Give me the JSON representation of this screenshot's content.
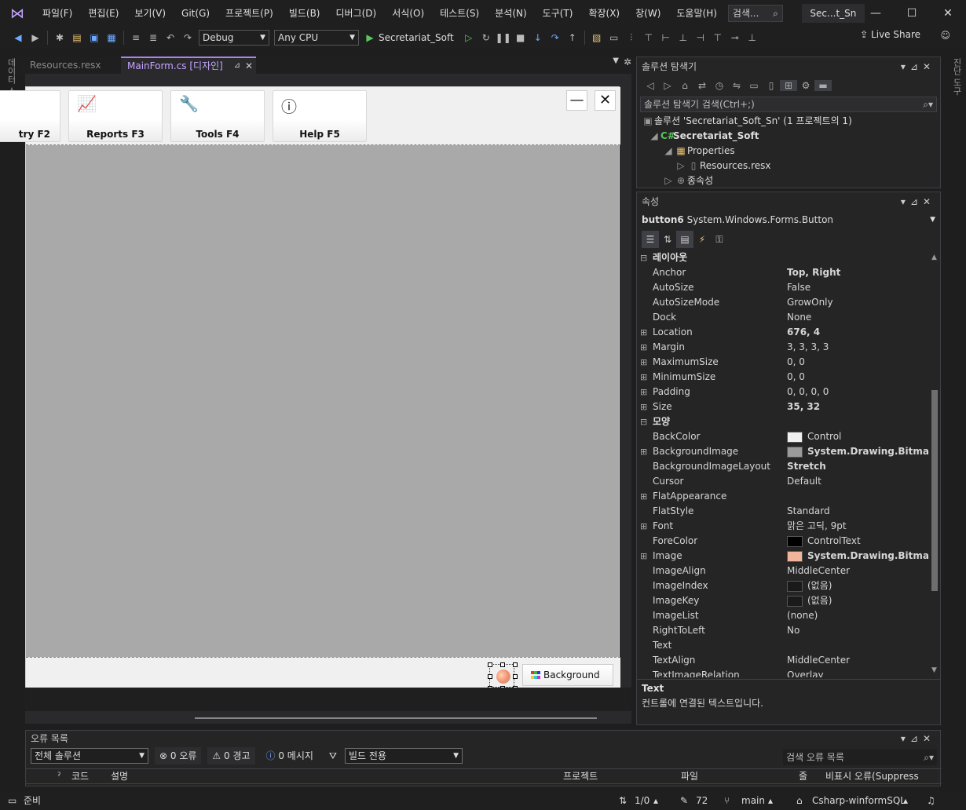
{
  "menu": {
    "items": [
      "파일(F)",
      "편집(E)",
      "보기(V)",
      "Git(G)",
      "프로젝트(P)",
      "빌드(B)",
      "디버그(D)",
      "서식(O)",
      "테스트(S)",
      "분석(N)",
      "도구(T)",
      "확장(X)",
      "창(W)",
      "도움말(H)"
    ],
    "search": "검색...",
    "solution_title": "Sec...t_Sn"
  },
  "toolbar": {
    "config": "Debug",
    "platform": "Any CPU",
    "start_label": "Secretariat_Soft",
    "live_share": "Live Share"
  },
  "rails": {
    "left": "데이터 소스",
    "right": "진단 도구"
  },
  "doc_tabs": {
    "resx": "Resources.resx",
    "main": "MainForm.cs [디자인]"
  },
  "form": {
    "buttons": [
      {
        "label": "try F2",
        "icon": "entry-icon"
      },
      {
        "label": "Reports F3",
        "icon": "chart-icon"
      },
      {
        "label": "Tools F4",
        "icon": "wrench-icon"
      },
      {
        "label": "Help F5",
        "icon": "help-icon"
      }
    ],
    "background_button": "Background"
  },
  "solution_explorer": {
    "title": "솔루션 탐색기",
    "search_placeholder": "솔루션 탐색기 검색(Ctrl+;)",
    "tree": [
      {
        "label": "솔루션 'Secretariat_Soft_Sn' (1 프로젝트의 1)",
        "indent": 0,
        "icon": "solution-icon"
      },
      {
        "label": "Secretariat_Soft",
        "indent": 1,
        "icon": "csharp-project-icon",
        "bold": true
      },
      {
        "label": "Properties",
        "indent": 2,
        "icon": "folder-icon"
      },
      {
        "label": "Resources.resx",
        "indent": 3,
        "icon": "resx-file-icon"
      },
      {
        "label": "종속성",
        "indent": 2,
        "icon": "dependencies-icon"
      }
    ]
  },
  "properties": {
    "title": "속성",
    "object_name": "button6",
    "object_type": "System.Windows.Forms.Button",
    "rows": [
      {
        "type": "cat",
        "name": "레이아웃"
      },
      {
        "name": "Anchor",
        "value": "Top, Right",
        "bold": true
      },
      {
        "name": "AutoSize",
        "value": "False"
      },
      {
        "name": "AutoSizeMode",
        "value": "GrowOnly"
      },
      {
        "name": "Dock",
        "value": "None"
      },
      {
        "name": "Location",
        "value": "676, 4",
        "bold": true,
        "exp": true
      },
      {
        "name": "Margin",
        "value": "3, 3, 3, 3",
        "exp": true
      },
      {
        "name": "MaximumSize",
        "value": "0, 0",
        "exp": true
      },
      {
        "name": "MinimumSize",
        "value": "0, 0",
        "exp": true
      },
      {
        "name": "Padding",
        "value": "0, 0, 0, 0",
        "exp": true
      },
      {
        "name": "Size",
        "value": "35, 32",
        "bold": true,
        "exp": true
      },
      {
        "type": "cat",
        "name": "모양"
      },
      {
        "name": "BackColor",
        "value": "Control",
        "swatch": "#f0f0f0"
      },
      {
        "name": "BackgroundImage",
        "value": "System.Drawing.Bitmap",
        "bold": true,
        "exp": true,
        "swatch": "#9a9a9a"
      },
      {
        "name": "BackgroundImageLayout",
        "value": "Stretch",
        "bold": true
      },
      {
        "name": "Cursor",
        "value": "Default"
      },
      {
        "name": "FlatAppearance",
        "value": "",
        "exp": true
      },
      {
        "name": "FlatStyle",
        "value": "Standard"
      },
      {
        "name": "Font",
        "value": "맑은 고딕, 9pt",
        "exp": true
      },
      {
        "name": "ForeColor",
        "value": "ControlText",
        "swatch": "#000000"
      },
      {
        "name": "Image",
        "value": "System.Drawing.Bitmap",
        "bold": true,
        "exp": true,
        "swatch": "#f2b49a"
      },
      {
        "name": "ImageAlign",
        "value": "MiddleCenter"
      },
      {
        "name": "ImageIndex",
        "value": "(없음)",
        "swatch": "#1a1a1a"
      },
      {
        "name": "ImageKey",
        "value": "(없음)",
        "swatch": "#1a1a1a"
      },
      {
        "name": "ImageList",
        "value": "(none)"
      },
      {
        "name": "RightToLeft",
        "value": "No"
      },
      {
        "name": "Text",
        "value": ""
      },
      {
        "name": "TextAlign",
        "value": "MiddleCenter"
      },
      {
        "name": "TextImageRelation",
        "value": "Overlay"
      }
    ],
    "desc_title": "Text",
    "desc_text": "컨트롤에 연결된 텍스트입니다."
  },
  "error_list": {
    "title": "오류 목록",
    "scope": "전체 솔루션",
    "errors": "0 오류",
    "warnings": "0 경고",
    "messages": "0 메시지",
    "build_filter": "빌드 전용",
    "search": "검색 오류 목록",
    "columns": [
      "코드",
      "설명",
      "프로젝트",
      "파일",
      "줄",
      "비표시 오류(Suppress"
    ]
  },
  "status": {
    "ready": "준비",
    "lines": "1/0",
    "edits": "72",
    "branch": "main",
    "repo": "Csharp-winformSQL"
  },
  "colors": {
    "accent": "#b180f0",
    "selection": "#3f3f46"
  }
}
